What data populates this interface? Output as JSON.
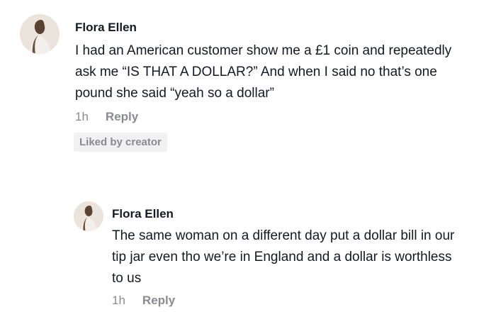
{
  "comments": [
    {
      "username": "Flora Ellen",
      "text": "I had an American customer show me a £1 coin and repeatedly ask me “IS THAT A DOLLAR?” And when I said no that’s one pound she said “yeah so a dollar”",
      "time": "1h",
      "reply_label": "Reply",
      "liked_badge": "Liked by creator"
    },
    {
      "username": "Flora Ellen",
      "text": "The same woman on a different day put a dollar bill in our tip jar even tho we’re in England and a dollar is worthless to us",
      "time": "1h",
      "reply_label": "Reply"
    }
  ]
}
